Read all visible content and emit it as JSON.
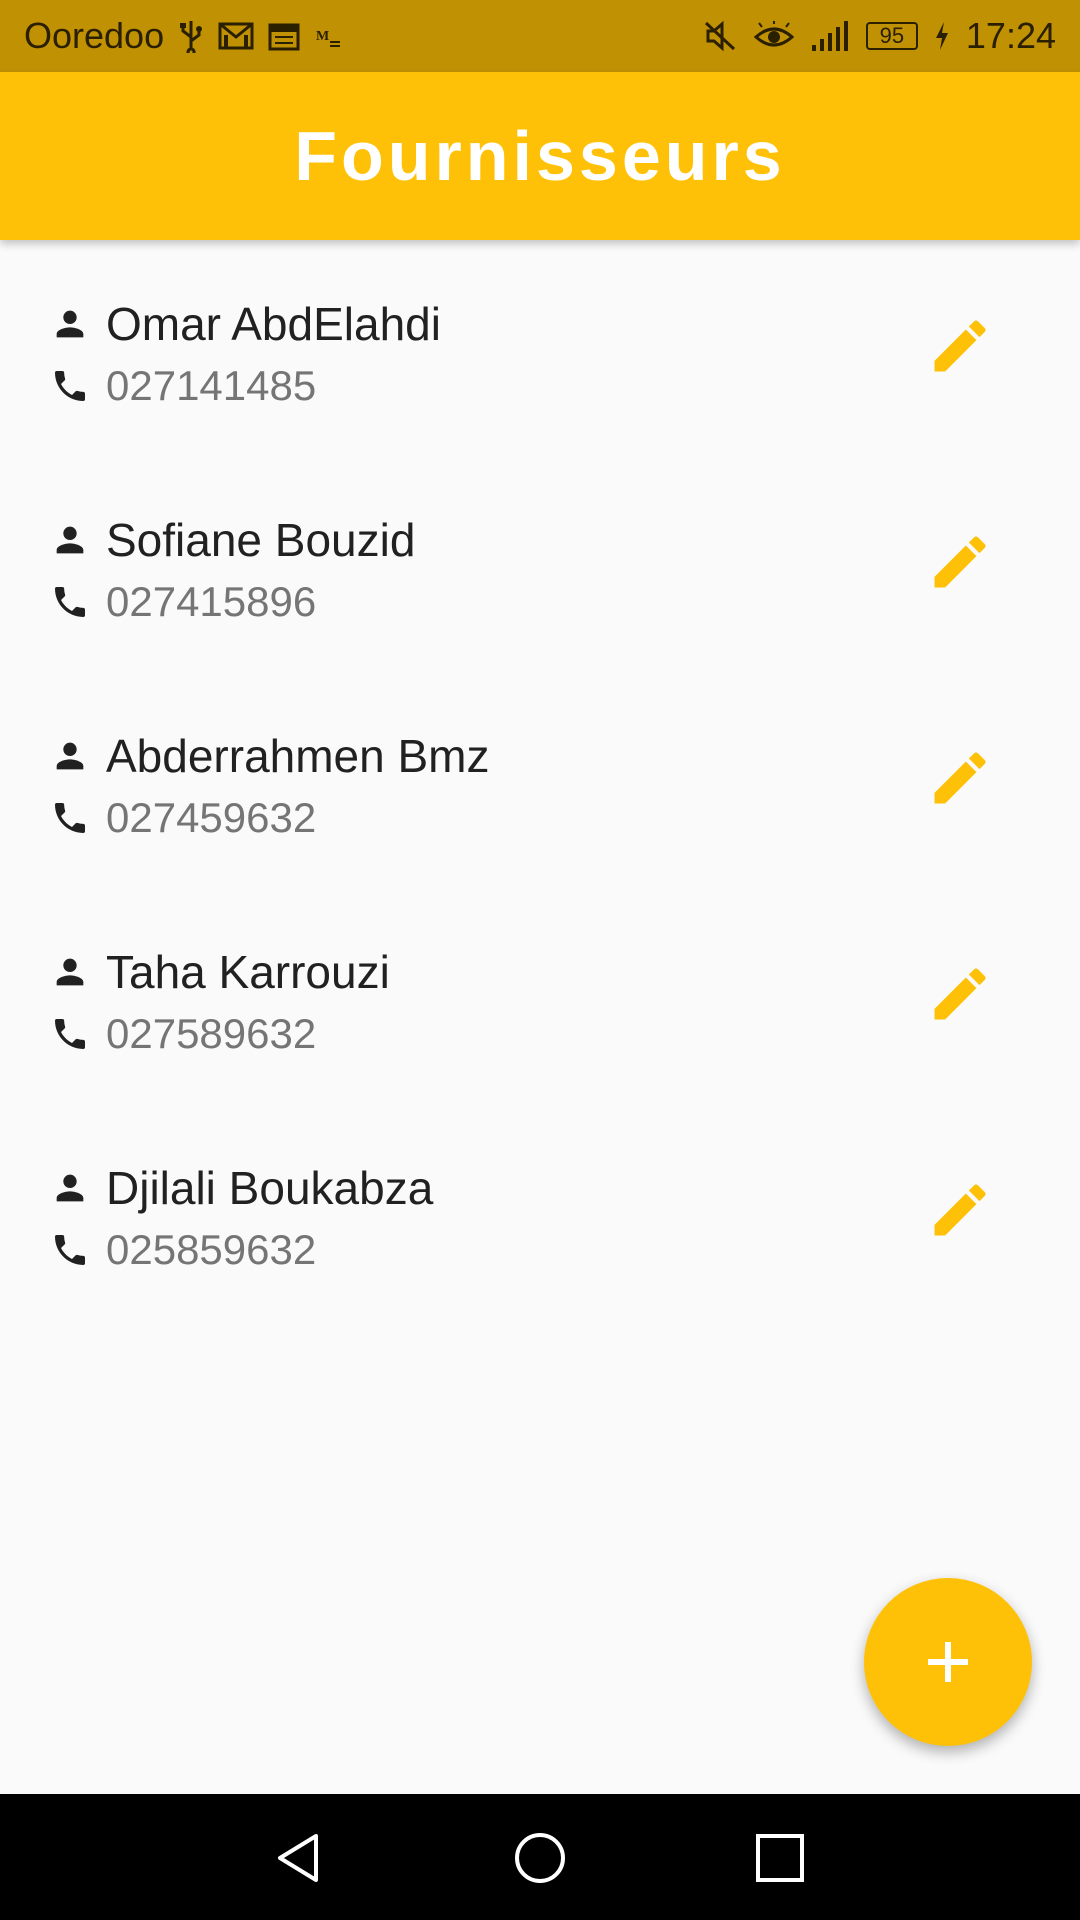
{
  "status_bar": {
    "carrier": "Ooredoo",
    "battery": "95",
    "time": "17:24",
    "left_icons": [
      "usb-icon",
      "gmail-icon",
      "calendar-icon",
      "mail-icon"
    ],
    "right_icons": [
      "mute-icon",
      "eye-icon",
      "signal-icon",
      "battery-icon",
      "charging-icon"
    ]
  },
  "app_bar": {
    "title": "Fournisseurs",
    "color": "#ffc107"
  },
  "suppliers": [
    {
      "name": "Omar AbdElahdi",
      "phone": "027141485"
    },
    {
      "name": "Sofiane Bouzid",
      "phone": "027415896"
    },
    {
      "name": "Abderrahmen Bmz",
      "phone": "027459632"
    },
    {
      "name": "Taha Karrouzi",
      "phone": "027589632"
    },
    {
      "name": "Djilali Boukabza",
      "phone": "025859632"
    }
  ],
  "icons": {
    "person": "person-icon",
    "phone": "phone-icon",
    "edit": "edit-icon",
    "add": "add-icon"
  },
  "nav_bar": {
    "buttons": [
      "back-icon",
      "home-icon",
      "recents-icon"
    ]
  }
}
